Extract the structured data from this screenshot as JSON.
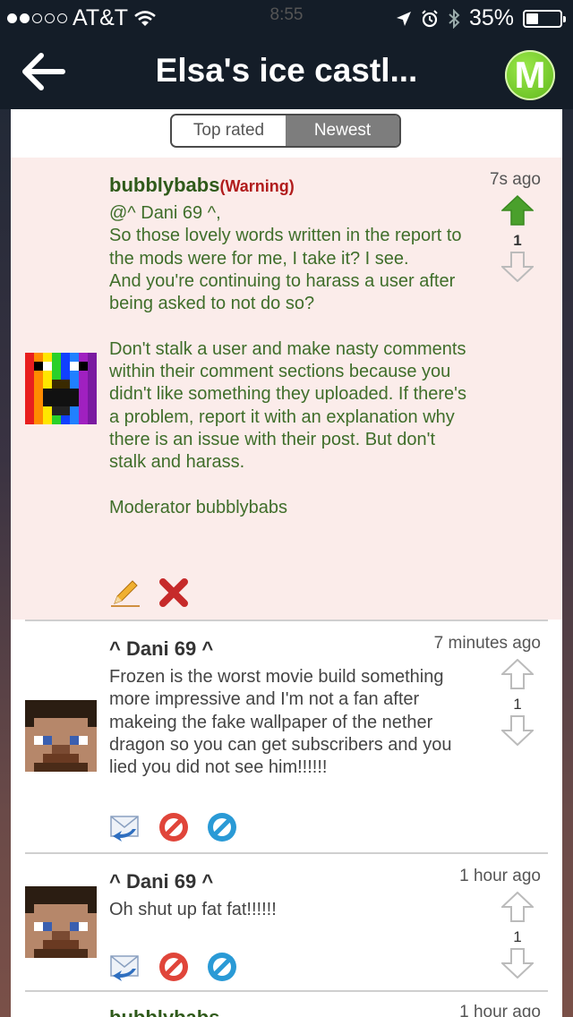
{
  "status_bar": {
    "carrier": "AT&T",
    "time": "8:55",
    "battery": "35%",
    "battery_level": 0.35
  },
  "nav": {
    "title": "Elsa's ice castl..."
  },
  "sort": {
    "options": [
      "Top rated",
      "Newest"
    ],
    "selected": "Newest"
  },
  "comments": [
    {
      "user": "bubblybabs",
      "badge": "(Warning)",
      "time": "7s ago",
      "score": "1",
      "upvoted": true,
      "text": "@^ Dani 69 ^,\nSo those lovely words written in the report to the mods were for me, I take it? I see.\nAnd you're continuing to harass a user after being asked to not do so?\n\nDon't stalk a user and make nasty comments within their comment sections because you didn't like something they uploaded. If there's a problem, report it with an explanation why there is an issue with their post. But don't stalk and harass.\n\nModerator bubblybabs"
    },
    {
      "user": "^ Dani 69 ^",
      "time": "7 minutes ago",
      "score": "1",
      "text": "Frozen is the worst movie build something more impressive and I'm not a fan after makeing the fake wallpaper of the nether dragon so you can get subscribers and you lied you did not see him!!!!!!"
    },
    {
      "user": "^ Dani 69 ^",
      "time": "1 hour ago",
      "score": "1",
      "text": "Oh shut up fat fat!!!!!!"
    },
    {
      "user": "bubblybabs",
      "time": "1 hour ago"
    }
  ],
  "colors": {
    "moderator_bg": "#fbecea",
    "moderator_text": "#3f6e2a",
    "warning": "#b11c1c",
    "upvote_active": "#4aa02c",
    "nav_bg": "#141d28"
  }
}
